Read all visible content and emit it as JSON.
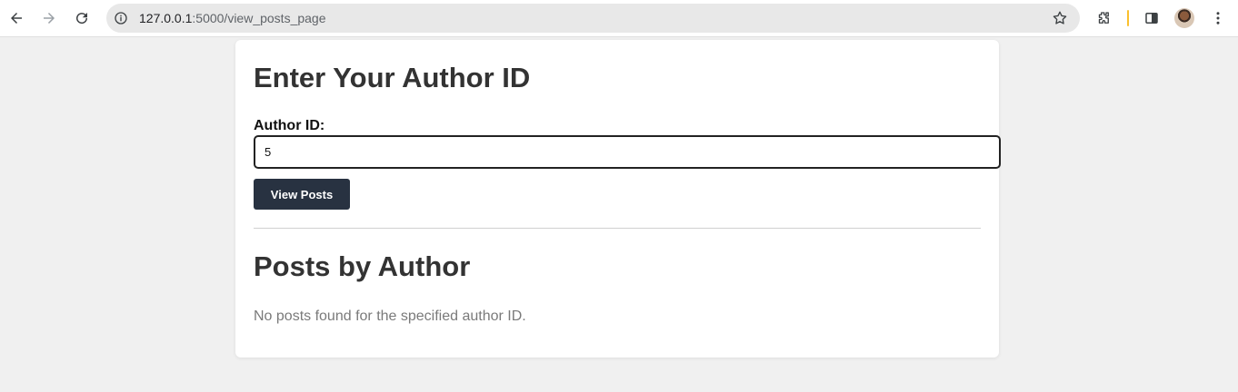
{
  "browser": {
    "url_host": "127.0.0.1",
    "url_path": ":5000/view_posts_page",
    "icons": [
      "back-arrow-icon",
      "forward-arrow-icon",
      "reload-icon",
      "site-info-icon",
      "bookmark-star-icon",
      "extensions-icon",
      "side-panel-icon",
      "profile-avatar",
      "kebab-menu-icon"
    ]
  },
  "page": {
    "heading": "Enter Your Author ID",
    "author_label": "Author ID:",
    "author_value": "5",
    "submit_label": "View Posts",
    "results_heading": "Posts by Author",
    "results_message": "No posts found for the specified author ID."
  },
  "colors": {
    "page_bg": "#f0f0f0",
    "card_bg": "#ffffff",
    "button_bg": "#283241",
    "heading_text": "#333333",
    "muted_text": "#7a7a7a"
  }
}
